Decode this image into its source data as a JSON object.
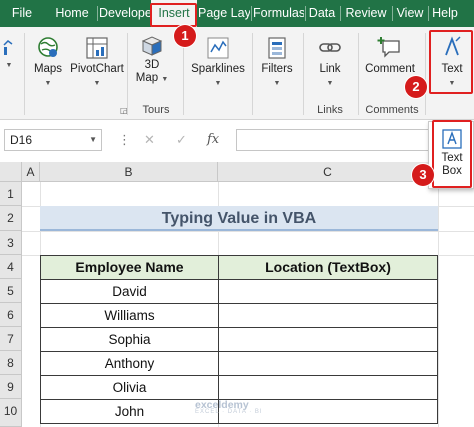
{
  "tabs": [
    "File",
    "Home",
    "Develope",
    "Insert",
    "Page Lay",
    "Formulas",
    "Data",
    "Review",
    "View",
    "Help"
  ],
  "ribbon": {
    "maps_label": "Maps",
    "pivotchart_label": "PivotChart",
    "map3d_label_line1": "3D",
    "map3d_label_line2": "Map",
    "tours_label": "Tours",
    "sparklines_label": "Sparklines",
    "filters_label": "Filters",
    "link_label": "Link",
    "links_label": "Links",
    "comment_label": "Comment",
    "comments_label": "Comments",
    "text_label": "Text"
  },
  "popup": {
    "textbox_line1": "Text",
    "textbox_line2": "Box"
  },
  "formula_bar": {
    "namebox": "D16",
    "cancel": "✕",
    "enter": "✓",
    "fx": "fx",
    "formula": ""
  },
  "columns": [
    "A",
    "B",
    "C"
  ],
  "rows": [
    "1",
    "2",
    "3",
    "4",
    "5",
    "6",
    "7",
    "8",
    "9",
    "10"
  ],
  "sheet": {
    "title": "Typing Value in VBA",
    "headers": [
      "Employee Name",
      "Location (TextBox)"
    ],
    "employees": [
      "David",
      "Williams",
      "Sophia",
      "Anthony",
      "Olivia",
      "John"
    ]
  },
  "annotations": [
    "1",
    "2",
    "3"
  ],
  "watermark": {
    "name": "exceldemy",
    "tagline": "EXCEL · DATA · BI"
  },
  "colors": {
    "ribbon_tab_bar": "#217346",
    "highlight": "#e02020",
    "header_fill": "#e2efda",
    "title_fill": "#dbe5f1"
  }
}
